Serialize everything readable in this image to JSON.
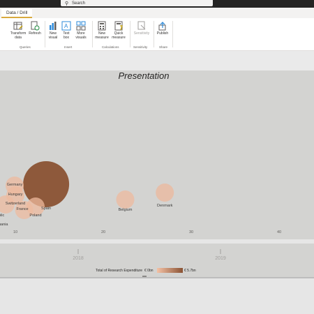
{
  "search": {
    "placeholder": "Search"
  },
  "tabs": {
    "active": "Data / Drill"
  },
  "ribbon": {
    "transform": "Transform data",
    "refresh": "Refresh",
    "new_visual": "New visual",
    "text_box": "Text box",
    "more_visuals": "More visuals",
    "new_measure": "New measure",
    "quick_measure": "Quick measure",
    "sensitivity": "Sensitivity",
    "publish": "Publish",
    "groups": {
      "queries": "Queries",
      "insert": "Insert",
      "calculations": "Calculations",
      "sensitivity": "Sensitivity",
      "share": "Share"
    }
  },
  "visual": {
    "title": "Presentation"
  },
  "chart_data": {
    "type": "scatter",
    "title": "Presentation",
    "x_ticks": [
      "10",
      "20",
      "30",
      "40"
    ],
    "points": [
      {
        "label": "Germany",
        "x": 10.0,
        "size": 0.4
      },
      {
        "label": "Hungary",
        "x": 10.0,
        "size": 0.35
      },
      {
        "label": "Switzerland",
        "x": 9.8,
        "size": 0.3
      },
      {
        "label": "France",
        "x": 11.0,
        "size": 0.3
      },
      {
        "label": "Spain",
        "x": 13.5,
        "size": 5.7
      },
      {
        "label": "Poland",
        "x": 12.3,
        "size": 0.35
      },
      {
        "label": "Belgium",
        "x": 22.5,
        "size": 0.35
      },
      {
        "label": "Denmark",
        "x": 27.0,
        "size": 0.45
      }
    ],
    "partial_labels": [
      "olic",
      "uania"
    ],
    "play_axis": [
      "2018",
      "2019"
    ],
    "legend": {
      "title": "Total of Research Expenditure",
      "min": "€ 0bn",
      "max": "€ 5.7bn"
    },
    "colors": {
      "min": "#f4c1a5",
      "max": "#8a5233"
    }
  }
}
